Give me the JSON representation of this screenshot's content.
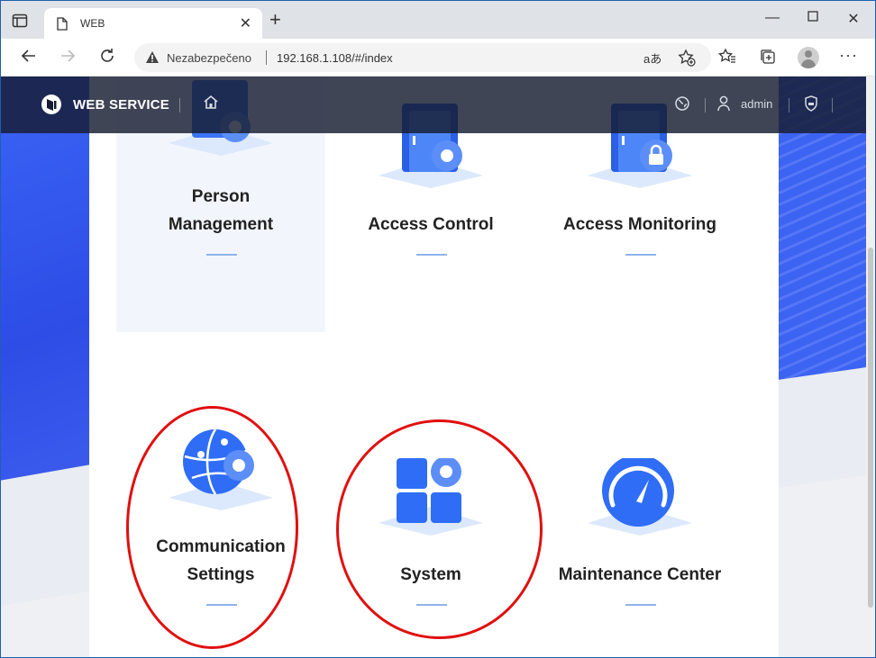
{
  "browser": {
    "tab_title": "WEB",
    "security_label": "Nezabezpečeno",
    "url": "192.168.1.108/#/index",
    "read_aloud": "aあ"
  },
  "app": {
    "name": "WEB SERVICE",
    "user": "admin"
  },
  "tiles": [
    {
      "label_line1": "Person",
      "label_line2": "Management",
      "active": true
    },
    {
      "label_line1": "",
      "label_line2": "Access Control"
    },
    {
      "label_line1": "",
      "label_line2": "Access Monitoring"
    },
    {
      "label_line1": "Communication",
      "label_line2": "Settings",
      "highlighted": true
    },
    {
      "label_line1": "",
      "label_line2": "System",
      "highlighted": true
    },
    {
      "label_line1": "",
      "label_line2": "Maintenance Center"
    }
  ],
  "colors": {
    "accent": "#2f6df6",
    "highlight_circle": "#e0100f",
    "header_bg": "#161c30"
  },
  "icons": {
    "person_management": "id-card-gear-icon",
    "access_control": "door-gear-icon",
    "access_monitoring": "door-lock-icon",
    "communication_settings": "globe-gear-icon",
    "system": "grid-gear-icon",
    "maintenance_center": "gauge-icon"
  }
}
